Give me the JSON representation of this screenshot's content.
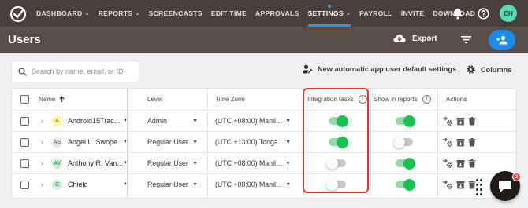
{
  "nav": {
    "items": [
      {
        "label": "DASHBOARD",
        "caret": "⌄"
      },
      {
        "label": "REPORTS",
        "caret": "⌄"
      },
      {
        "label": "SCREENCASTS"
      },
      {
        "label": "EDIT TIME"
      },
      {
        "label": "APPROVALS"
      },
      {
        "label": "SETTINGS",
        "caret": "⌄",
        "active": true
      },
      {
        "label": "PAYROLL"
      },
      {
        "label": "INVITE"
      },
      {
        "label": "DOWNLOAD"
      }
    ],
    "avatar": "CH",
    "icons": [
      "bell-icon",
      "help-icon"
    ]
  },
  "header": {
    "title": "Users",
    "export_label": "Export"
  },
  "toolbar": {
    "search_placeholder": "Search by name, email, or ID",
    "new_auto_label": "New automatic app user default settings",
    "columns_label": "Columns"
  },
  "table": {
    "headers": {
      "name": "Name",
      "level": "Level",
      "timezone": "Time Zone",
      "integration": "Integration tasks",
      "show_reports": "Show in reports",
      "actions": "Actions"
    },
    "rows": [
      {
        "initial": "A",
        "initial_bg": "#fff3a8",
        "initial_fg": "#7a6a00",
        "name": "Android15Trac...",
        "level": "Admin",
        "timezone": "(UTC +08:00) Manil...",
        "integration": true,
        "show_reports": true
      },
      {
        "initial": "AS",
        "initial_bg": "#e6e6e6",
        "initial_fg": "#555555",
        "name": "Angel L. Swope",
        "level": "Regular User",
        "timezone": "(UTC +13:00) Tonga...",
        "integration": true,
        "show_reports": false
      },
      {
        "initial": "AV",
        "initial_bg": "#c9f2d5",
        "initial_fg": "#1d7a3b",
        "name": "Anthony R. Van...",
        "level": "Regular User",
        "timezone": "(UTC +08:00) Manil...",
        "integration": false,
        "show_reports": true
      },
      {
        "initial": "C",
        "initial_bg": "#c9f2d5",
        "initial_fg": "#1d7a3b",
        "name": "Chielo",
        "level": "Regular User",
        "timezone": "(UTC +08:00) Manil...",
        "integration": false,
        "show_reports": true
      }
    ]
  },
  "chat": {
    "badge": "2"
  },
  "colors": {
    "nav_bg": "#4a3f3a",
    "header_bg": "#5a4e48",
    "accent_blue": "#1a8cf0",
    "toggle_on": "#19c34f",
    "highlight": "#e3372b"
  }
}
